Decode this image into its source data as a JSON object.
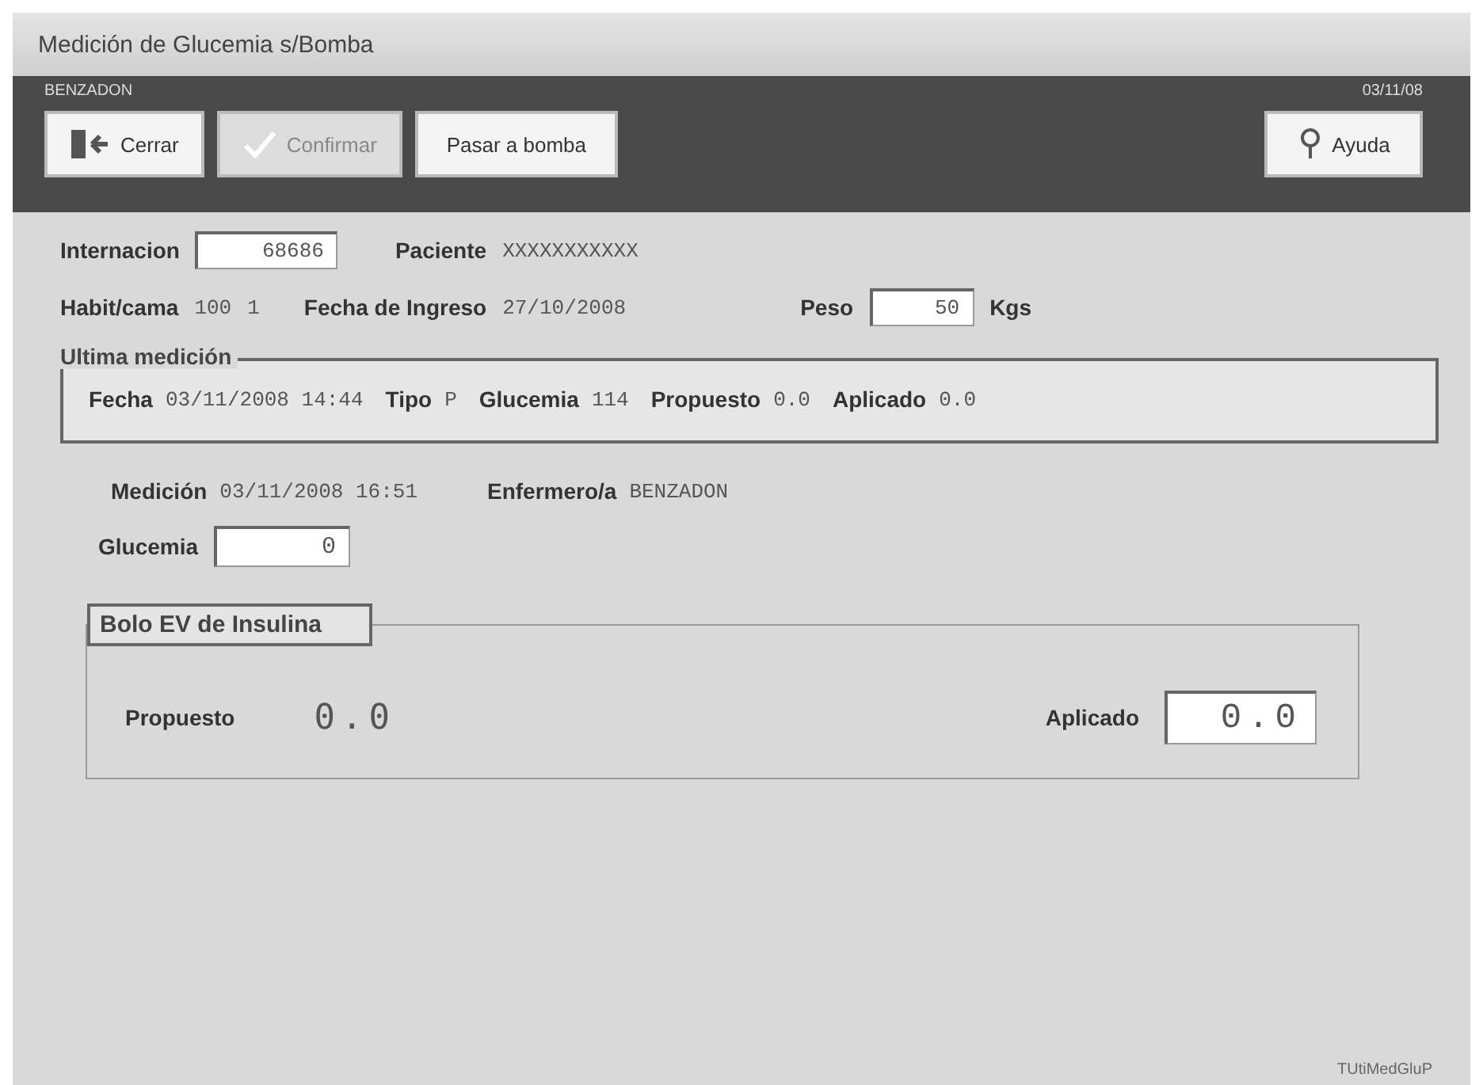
{
  "window": {
    "title": "Medición de Glucemia s/Bomba"
  },
  "toolbar": {
    "user": "BENZADON",
    "date": "03/11/08",
    "buttons": [
      {
        "kind": "exit",
        "label": "Cerrar",
        "disabled": false
      },
      {
        "kind": "check",
        "label": "Confirmar",
        "disabled": true
      },
      {
        "kind": "plain",
        "label": "Pasar a bomba",
        "disabled": false
      },
      {
        "kind": "help",
        "label": "Ayuda",
        "disabled": false
      }
    ]
  },
  "patient": {
    "internacion_label": "Internacion",
    "internacion": "68686",
    "paciente_label": "Paciente",
    "paciente": "XXXXXXXXXXX",
    "habit_label": "Habit/cama",
    "habitacion": "100",
    "cama": "1",
    "ingreso_label": "Fecha de Ingreso",
    "ingreso": "27/10/2008",
    "peso_label": "Peso",
    "peso": "50",
    "peso_unit": "Kgs"
  },
  "last_measurement": {
    "title": "Ultima medición",
    "items": [
      {
        "label": "Fecha",
        "value": "03/11/2008 14:44"
      },
      {
        "label": "Tipo",
        "value": "P"
      },
      {
        "label": "Glucemia",
        "value": "114"
      },
      {
        "label": "Propuesto",
        "value": "0.0"
      },
      {
        "label": "Aplicado",
        "value": "0.0"
      }
    ]
  },
  "measurement": {
    "label": "Medición",
    "value": "03/11/2008 16:51",
    "nurse_label": "Enfermero/a",
    "nurse": "BENZADON",
    "glucemia_label": "Glucemia",
    "glucemia": "0"
  },
  "bolus": {
    "title": "Bolo EV de Insulina",
    "propuesto_label": "Propuesto",
    "propuesto": "0.0",
    "aplicado_label": "Aplicado",
    "aplicado": "0.0"
  },
  "status_bar": {
    "form_id": "TUtiMedGluP"
  }
}
